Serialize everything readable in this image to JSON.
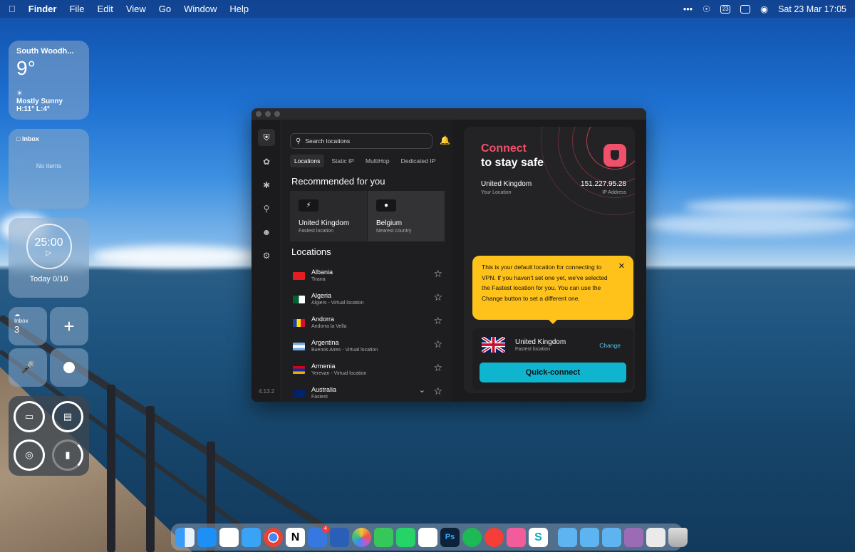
{
  "menubar": {
    "apple": "",
    "items": [
      "Finder",
      "File",
      "Edit",
      "View",
      "Go",
      "Window",
      "Help"
    ],
    "calendar_day": "23",
    "datetime": "Sat 23 Mar  17:05"
  },
  "weather": {
    "city": "South Woodh...",
    "temp": "9°",
    "condition": "Mostly Sunny",
    "hilo": "H:11° L:4°"
  },
  "inbox_widget": {
    "title": "Inbox",
    "empty": "No items"
  },
  "timer_widget": {
    "time": "25:00",
    "today": "Today 0/10"
  },
  "small_widgets": {
    "inbox_label": "Inbox",
    "inbox_count": "3"
  },
  "vpn": {
    "search_placeholder": "Search locations",
    "tabs": [
      "Locations",
      "Static IP",
      "MultiHop",
      "Dedicated IP"
    ],
    "recommended_title": "Recommended for you",
    "recommended": [
      {
        "name": "United Kingdom",
        "sub": "Fastest location",
        "icon": "bolt-icon"
      },
      {
        "name": "Belgium",
        "sub": "Nearest country",
        "icon": "pin-icon"
      }
    ],
    "locations_title": "Locations",
    "locations": [
      {
        "name": "Albania",
        "sub": "Tirana",
        "flag": "#e41e20"
      },
      {
        "name": "Algeria",
        "sub": "Algiers - Virtual location",
        "flag": "#006233"
      },
      {
        "name": "Andorra",
        "sub": "Andorra la Vella",
        "flag": "#1a3fb0"
      },
      {
        "name": "Argentina",
        "sub": "Buenos Aires - Virtual location",
        "flag": "#74acdf"
      },
      {
        "name": "Armenia",
        "sub": "Yerevan - Virtual location",
        "flag": "#d90012"
      },
      {
        "name": "Australia",
        "sub": "Fastest",
        "flag": "#012169"
      }
    ],
    "version": "4.13.2",
    "connect_line1": "Connect",
    "connect_line2": "to stay safe",
    "your_location": "United Kingdom",
    "your_location_label": "Your Location",
    "ip": "151.227.95.28",
    "ip_label": "IP Address",
    "tooltip": "This is your default location for connecting to VPN. If you haven't set one yet, we've selected the Fastest location for you. You can use the Change button to set a different one.",
    "default_name": "United Kingdom",
    "default_sub": "Fastest location",
    "change": "Change",
    "quick_connect": "Quick-connect",
    "accent": "#f0506a",
    "button_color": "#0fb4cf",
    "tooltip_color": "#ffc21a"
  },
  "dock": {
    "badge": "4"
  }
}
